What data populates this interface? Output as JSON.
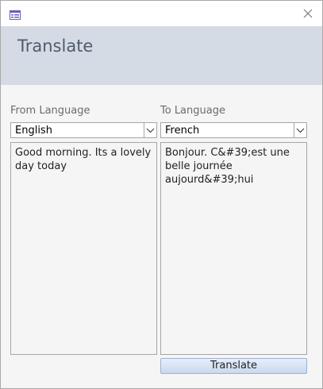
{
  "window": {
    "icon": "form-icon",
    "close_icon": "close-icon"
  },
  "header": {
    "title": "Translate"
  },
  "from": {
    "label": "From Language",
    "selected": "English",
    "text": "Good morning. Its a lovely day today"
  },
  "to": {
    "label": "To Language",
    "selected": "French",
    "text": "Bonjour. C&#39;est une belle journée aujourd&#39;hui"
  },
  "actions": {
    "translate_label": "Translate"
  }
}
